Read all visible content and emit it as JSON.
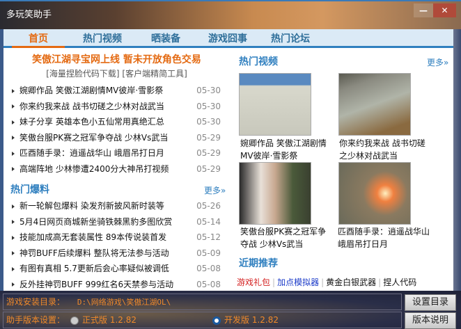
{
  "window": {
    "title": "多玩笑助手",
    "minimize": "—",
    "close": "✕"
  },
  "nav": {
    "tabs": [
      "首页",
      "热门视频",
      "晒装备",
      "游戏囧事",
      "热门论坛"
    ]
  },
  "headline": {
    "main": "笑傲江湖寻宝网上线 暂未开放角色交易",
    "sub": "[海量捏脸代码下载] [客户端精简工具]"
  },
  "news": [
    {
      "title": "婉卿作品 笑傲江湖剧情MV彼岸·雪影祭",
      "date": "05-30"
    },
    {
      "title": "你来约我来战 战书切磋之少林对战武当",
      "date": "05-30"
    },
    {
      "title": "妹子分享 英雄本色小五仙常用真绝汇总",
      "date": "05-30"
    },
    {
      "title": "笑傲台服PK赛之冠军争夺战 少林Vs武当",
      "date": "05-29"
    },
    {
      "title": "匹酉随手录：逍遥战华山 峨眉吊打日月",
      "date": "05-29"
    },
    {
      "title": "高端阵地 少林惨遭2400分大神吊打视频",
      "date": "05-29"
    }
  ],
  "leaks": {
    "title": "热门爆料",
    "more": "更多»",
    "items": [
      {
        "title": "新一轮解包爆料 染发剂新披风新时装等",
        "date": "05-26"
      },
      {
        "title": "5月4日网页商城新坐骑铁棘黑豹多图欣赏",
        "date": "05-14"
      },
      {
        "title": "技能加成高无套装属性 89本传说装首发",
        "date": "05-12"
      },
      {
        "title": "神罚BUFF后续爆料 整队将无法参与活动",
        "date": "05-09"
      },
      {
        "title": "有图有真相 5.7更新后会心率疑似被调低",
        "date": "05-08"
      },
      {
        "title": "反外挂神罚BUFF 999红名6天禁参与活动",
        "date": "05-08"
      }
    ]
  },
  "videos": {
    "title": "热门视频",
    "more": "更多»",
    "items": [
      {
        "caption": "婉卿作品 笑傲江湖剧情MV彼岸·雪影祭"
      },
      {
        "caption": "你来约我来战 战书切磋之少林对战武当"
      },
      {
        "caption": "笑傲台服PK赛之冠军争夺战 少林Vs武当"
      },
      {
        "caption": "匹酉随手录：逍遥战华山峨眉吊打日月"
      }
    ]
  },
  "recommend": {
    "title": "近期推荐",
    "links": [
      {
        "label": "游戏礼包",
        "color": "#d42020"
      },
      {
        "label": "加点模拟器",
        "color": "#1a3ac8"
      },
      {
        "label": "黄金白银武器",
        "color": "#111111"
      },
      {
        "label": "捏人代码",
        "color": "#111111"
      }
    ]
  },
  "bottom": {
    "dir_label": "游戏安装目录：",
    "dir_value": "D:\\网络游戏\\笑傲江湖OL\\",
    "version_label": "助手版本设置：",
    "stable": "正式版 1.2.82",
    "dev": "开发版 1.2.82",
    "selected": "dev",
    "set_dir": "设置目录",
    "version_info": "版本说明"
  }
}
